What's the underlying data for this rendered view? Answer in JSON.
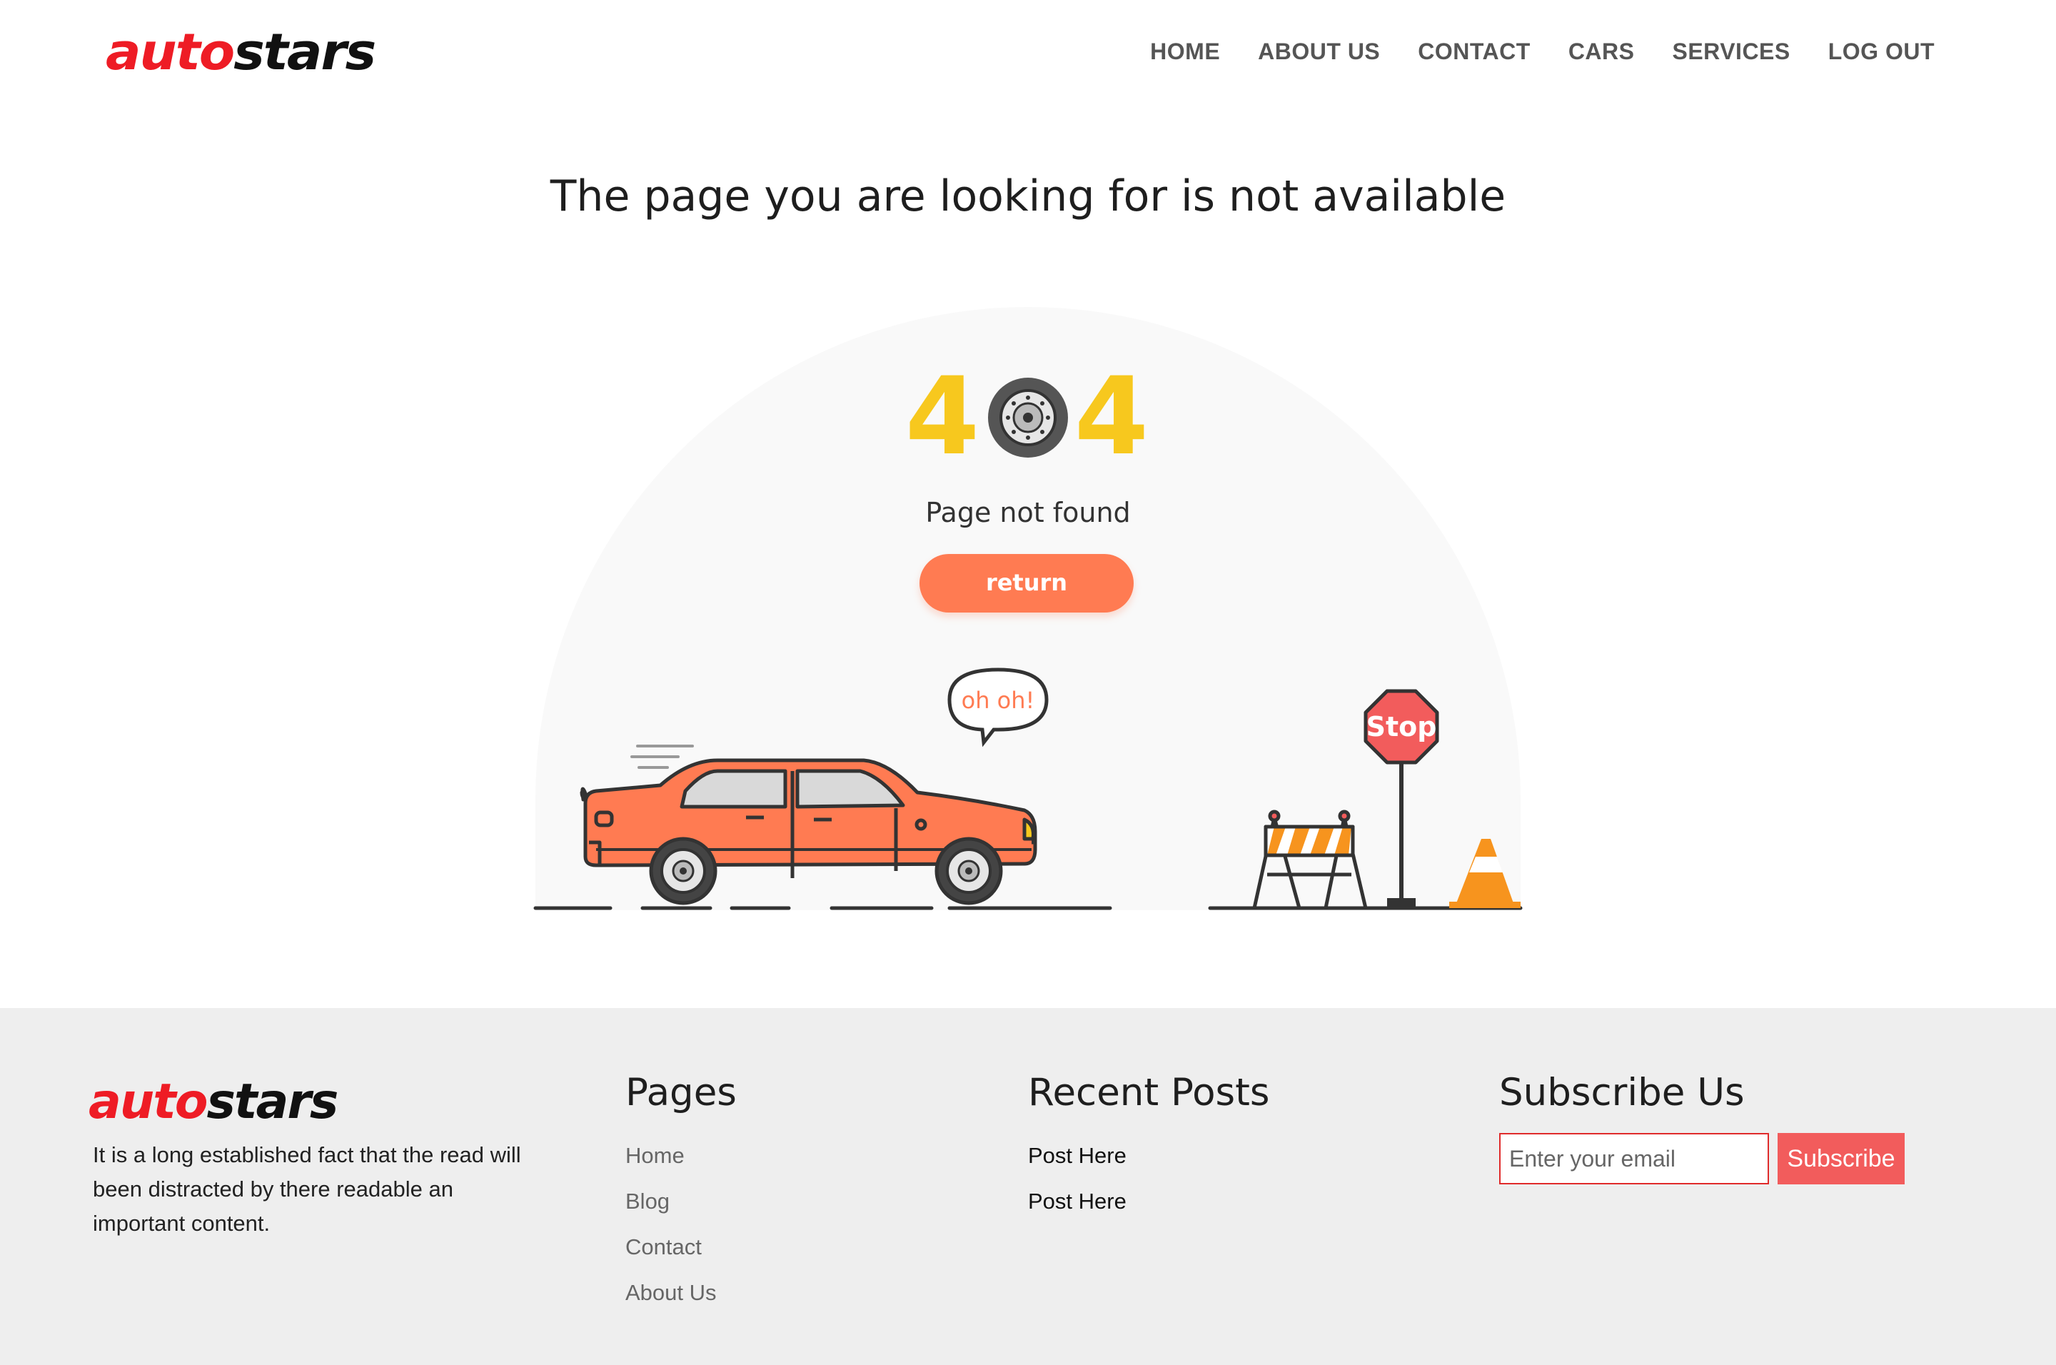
{
  "brand": {
    "part1": "auto",
    "part2": "stars",
    "red": "#ee1c25",
    "black": "#111111"
  },
  "nav": {
    "items": [
      "HOME",
      "ABOUT US",
      "CONTACT",
      "CARS",
      "SERVICES",
      "LOG OUT"
    ]
  },
  "main": {
    "title": "The page you are looking for is not available",
    "error_code_left": "4",
    "error_code_right": "4",
    "subtitle": "Page not found",
    "return_label": "return",
    "speech": "oh oh!",
    "sign": "Stop",
    "accent": "#ff7b52",
    "digit_color": "#f7c81e"
  },
  "footer": {
    "about": "It is a long established fact that the read will been distracted by there readable an important content.",
    "pages_title": "Pages",
    "pages": [
      "Home",
      "Blog",
      "Contact",
      "About Us"
    ],
    "posts_title": "Recent Posts",
    "posts": [
      "Post Here",
      "Post Here"
    ],
    "subscribe_title": "Subscribe Us",
    "email_placeholder": "Enter your email",
    "subscribe_label": "Subscribe"
  }
}
